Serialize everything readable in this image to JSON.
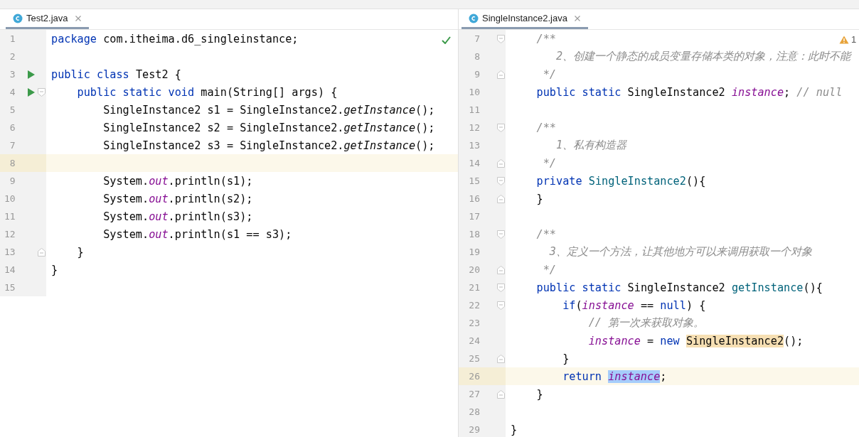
{
  "panes": [
    {
      "tab": {
        "label": "Test2.java",
        "selected": true
      },
      "indicator": {
        "kind": "check"
      },
      "lines": [
        {
          "number": "1",
          "run": false,
          "fold_start": false,
          "fold_end": false,
          "current": false,
          "tokens": [
            {
              "t": "package",
              "kind": "keyword"
            },
            {
              "t": " com.itheima.d6_singleinstance;",
              "kind": "plain"
            }
          ]
        },
        {
          "number": "2",
          "run": false,
          "fold_start": false,
          "fold_end": false,
          "current": false
        },
        {
          "number": "3",
          "run": true,
          "fold_start": false,
          "fold_end": false,
          "current": false,
          "tokens": [
            {
              "t": "public class",
              "kind": "keyword"
            },
            {
              "t": " Test2 {",
              "kind": "plain"
            }
          ]
        },
        {
          "number": "4",
          "run": true,
          "fold_start": true,
          "fold_end": false,
          "current": false,
          "tokens": [
            {
              "t": "    public static void",
              "kind": "keyword"
            },
            {
              "t": " main(String[] args) {",
              "kind": "plain"
            }
          ]
        },
        {
          "number": "5",
          "run": false,
          "fold_start": false,
          "fold_end": false,
          "current": false,
          "tokens": [
            {
              "t": "        SingleInstance2 s1 = SingleInstance2.",
              "kind": "plain"
            },
            {
              "t": "getInstance",
              "kind": "method"
            },
            {
              "t": "();",
              "kind": "plain"
            }
          ]
        },
        {
          "number": "6",
          "run": false,
          "fold_start": false,
          "fold_end": false,
          "current": false,
          "tokens": [
            {
              "t": "        SingleInstance2 s2 = SingleInstance2.",
              "kind": "plain"
            },
            {
              "t": "getInstance",
              "kind": "method"
            },
            {
              "t": "();",
              "kind": "plain"
            }
          ]
        },
        {
          "number": "7",
          "run": false,
          "fold_start": false,
          "fold_end": false,
          "current": false,
          "tokens": [
            {
              "t": "        SingleInstance2 s3 = SingleInstance2.",
              "kind": "plain"
            },
            {
              "t": "getInstance",
              "kind": "method"
            },
            {
              "t": "();",
              "kind": "plain"
            }
          ]
        },
        {
          "number": "8",
          "run": false,
          "fold_start": false,
          "fold_end": false,
          "current": true
        },
        {
          "number": "9",
          "run": false,
          "fold_start": false,
          "fold_end": false,
          "current": false,
          "tokens": [
            {
              "t": "        System.",
              "kind": "plain"
            },
            {
              "t": "out",
              "kind": "field"
            },
            {
              "t": ".println(s1);",
              "kind": "plain"
            }
          ]
        },
        {
          "number": "10",
          "run": false,
          "fold_start": false,
          "fold_end": false,
          "current": false,
          "tokens": [
            {
              "t": "        System.",
              "kind": "plain"
            },
            {
              "t": "out",
              "kind": "field"
            },
            {
              "t": ".println(s2);",
              "kind": "plain"
            }
          ]
        },
        {
          "number": "11",
          "run": false,
          "fold_start": false,
          "fold_end": false,
          "current": false,
          "tokens": [
            {
              "t": "        System.",
              "kind": "plain"
            },
            {
              "t": "out",
              "kind": "field"
            },
            {
              "t": ".println(s3);",
              "kind": "plain"
            }
          ]
        },
        {
          "number": "12",
          "run": false,
          "fold_start": false,
          "fold_end": false,
          "current": false,
          "tokens": [
            {
              "t": "        System.",
              "kind": "plain"
            },
            {
              "t": "out",
              "kind": "field"
            },
            {
              "t": ".println(s1 == s3);",
              "kind": "plain"
            }
          ]
        },
        {
          "number": "13",
          "run": false,
          "fold_start": false,
          "fold_end": true,
          "current": false,
          "tokens": [
            {
              "t": "    }",
              "kind": "plain"
            }
          ]
        },
        {
          "number": "14",
          "run": false,
          "fold_start": false,
          "fold_end": false,
          "current": false,
          "tokens": [
            {
              "t": "}",
              "kind": "plain"
            }
          ]
        },
        {
          "number": "15",
          "run": false,
          "fold_start": false,
          "fold_end": false,
          "current": false
        }
      ]
    },
    {
      "tab": {
        "label": "SingleInstance2.java",
        "selected": true
      },
      "indicator": {
        "kind": "warning",
        "count": "1"
      },
      "lines": [
        {
          "number": "7",
          "run": false,
          "fold_start": true,
          "fold_end": false,
          "current": false,
          "tokens": [
            {
              "t": "    /**",
              "kind": "comment"
            }
          ]
        },
        {
          "number": "8",
          "run": false,
          "fold_start": false,
          "fold_end": false,
          "current": false,
          "tokens": [
            {
              "t": "       2、创建一个静态的成员变量存储本类的对象，注意：此时不能",
              "kind": "comment"
            }
          ]
        },
        {
          "number": "9",
          "run": false,
          "fold_start": false,
          "fold_end": true,
          "current": false,
          "tokens": [
            {
              "t": "     */",
              "kind": "comment"
            }
          ]
        },
        {
          "number": "10",
          "run": false,
          "fold_start": false,
          "fold_end": false,
          "current": false,
          "tokens": [
            {
              "t": "    public static",
              "kind": "keyword"
            },
            {
              "t": " SingleInstance2 ",
              "kind": "plain"
            },
            {
              "t": "instance",
              "kind": "field"
            },
            {
              "t": ";",
              "kind": "plain"
            },
            {
              "t": " // null",
              "kind": "comment"
            }
          ]
        },
        {
          "number": "11",
          "run": false,
          "fold_start": false,
          "fold_end": false,
          "current": false
        },
        {
          "number": "12",
          "run": false,
          "fold_start": true,
          "fold_end": false,
          "current": false,
          "tokens": [
            {
              "t": "    /**",
              "kind": "comment"
            }
          ]
        },
        {
          "number": "13",
          "run": false,
          "fold_start": false,
          "fold_end": false,
          "current": false,
          "tokens": [
            {
              "t": "       1、私有构造器",
              "kind": "comment"
            }
          ]
        },
        {
          "number": "14",
          "run": false,
          "fold_start": false,
          "fold_end": true,
          "current": false,
          "tokens": [
            {
              "t": "     */",
              "kind": "comment"
            }
          ]
        },
        {
          "number": "15",
          "run": false,
          "fold_start": true,
          "fold_end": false,
          "current": false,
          "tokens": [
            {
              "t": "    private",
              "kind": "keyword"
            },
            {
              "t": " SingleInstance2",
              "kind": "declaration"
            },
            {
              "t": "(){",
              "kind": "plain"
            }
          ]
        },
        {
          "number": "16",
          "run": false,
          "fold_start": false,
          "fold_end": true,
          "current": false,
          "tokens": [
            {
              "t": "    }",
              "kind": "plain"
            }
          ]
        },
        {
          "number": "17",
          "run": false,
          "fold_start": false,
          "fold_end": false,
          "current": false
        },
        {
          "number": "18",
          "run": false,
          "fold_start": true,
          "fold_end": false,
          "current": false,
          "tokens": [
            {
              "t": "    /**",
              "kind": "comment"
            }
          ]
        },
        {
          "number": "19",
          "run": false,
          "fold_start": false,
          "fold_end": false,
          "current": false,
          "tokens": [
            {
              "t": "      3、定义一个方法，让其他地方可以来调用获取一个对象",
              "kind": "comment"
            }
          ]
        },
        {
          "number": "20",
          "run": false,
          "fold_start": false,
          "fold_end": true,
          "current": false,
          "tokens": [
            {
              "t": "     */",
              "kind": "comment"
            }
          ]
        },
        {
          "number": "21",
          "run": false,
          "fold_start": true,
          "fold_end": false,
          "current": false,
          "tokens": [
            {
              "t": "    public static",
              "kind": "keyword"
            },
            {
              "t": " SingleInstance2 ",
              "kind": "plain"
            },
            {
              "t": "getInstance",
              "kind": "declaration"
            },
            {
              "t": "(){",
              "kind": "plain"
            }
          ]
        },
        {
          "number": "22",
          "run": false,
          "fold_start": true,
          "fold_end": false,
          "current": false,
          "tokens": [
            {
              "t": "        if",
              "kind": "keyword"
            },
            {
              "t": "(",
              "kind": "plain"
            },
            {
              "t": "instance",
              "kind": "field"
            },
            {
              "t": " == ",
              "kind": "plain"
            },
            {
              "t": "null",
              "kind": "keyword"
            },
            {
              "t": ") {",
              "kind": "plain"
            }
          ]
        },
        {
          "number": "23",
          "run": false,
          "fold_start": false,
          "fold_end": false,
          "current": false,
          "tokens": [
            {
              "t": "            // 第一次来获取对象。",
              "kind": "comment"
            }
          ]
        },
        {
          "number": "24",
          "run": false,
          "fold_start": false,
          "fold_end": false,
          "current": false,
          "tokens": [
            {
              "t": "            instance",
              "kind": "field"
            },
            {
              "t": " = ",
              "kind": "plain"
            },
            {
              "t": "new ",
              "kind": "keyword"
            },
            {
              "t": "SingleInstance2",
              "kind": "usage-highlight"
            },
            {
              "t": "();",
              "kind": "plain"
            }
          ]
        },
        {
          "number": "25",
          "run": false,
          "fold_start": false,
          "fold_end": true,
          "current": false,
          "tokens": [
            {
              "t": "        }",
              "kind": "plain"
            }
          ]
        },
        {
          "number": "26",
          "run": false,
          "fold_start": false,
          "fold_end": false,
          "current": true,
          "tokens": [
            {
              "t": "        return ",
              "kind": "keyword"
            },
            {
              "t": "instance",
              "kind": "selected-field"
            },
            {
              "t": ";",
              "kind": "plain"
            }
          ]
        },
        {
          "number": "27",
          "run": false,
          "fold_start": false,
          "fold_end": true,
          "current": false,
          "tokens": [
            {
              "t": "    }",
              "kind": "plain"
            }
          ]
        },
        {
          "number": "28",
          "run": false,
          "fold_start": false,
          "fold_end": false,
          "current": false
        },
        {
          "number": "29",
          "run": false,
          "fold_start": false,
          "fold_end": false,
          "current": false,
          "tokens": [
            {
              "t": "}",
              "kind": "plain"
            }
          ]
        }
      ]
    }
  ]
}
